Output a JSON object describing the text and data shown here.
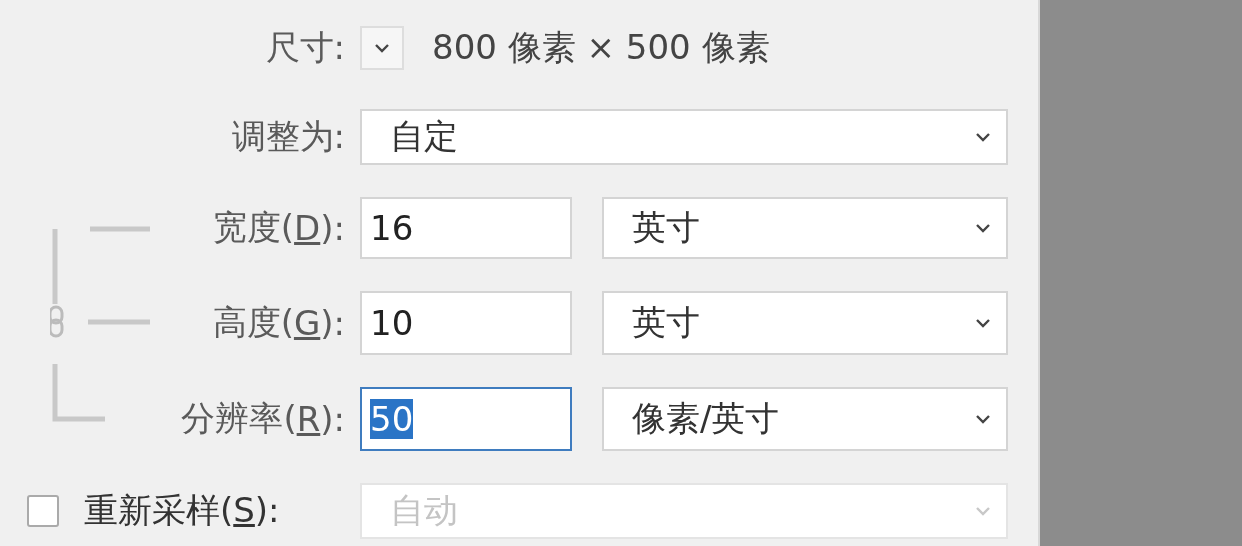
{
  "dimensions": {
    "label": "尺寸:",
    "value": "800 像素 × 500 像素"
  },
  "fit_to": {
    "label": "调整为:",
    "value": "自定"
  },
  "fields": [
    {
      "label": "宽度(",
      "key": "D",
      "suffix": "):",
      "value": "16",
      "selected": false,
      "unit": "英寸"
    },
    {
      "label": "高度(",
      "key": "G",
      "suffix": "):",
      "value": "10",
      "selected": false,
      "unit": "英寸"
    },
    {
      "label": "分辨率(",
      "key": "R",
      "suffix": "):",
      "value": "50",
      "selected": true,
      "unit": "像素/英寸"
    }
  ],
  "constrain": {
    "linked": true
  },
  "resample": {
    "checked": false,
    "label": "重新采样(",
    "key": "S",
    "suffix": "):",
    "value": "自动",
    "disabled": true
  }
}
